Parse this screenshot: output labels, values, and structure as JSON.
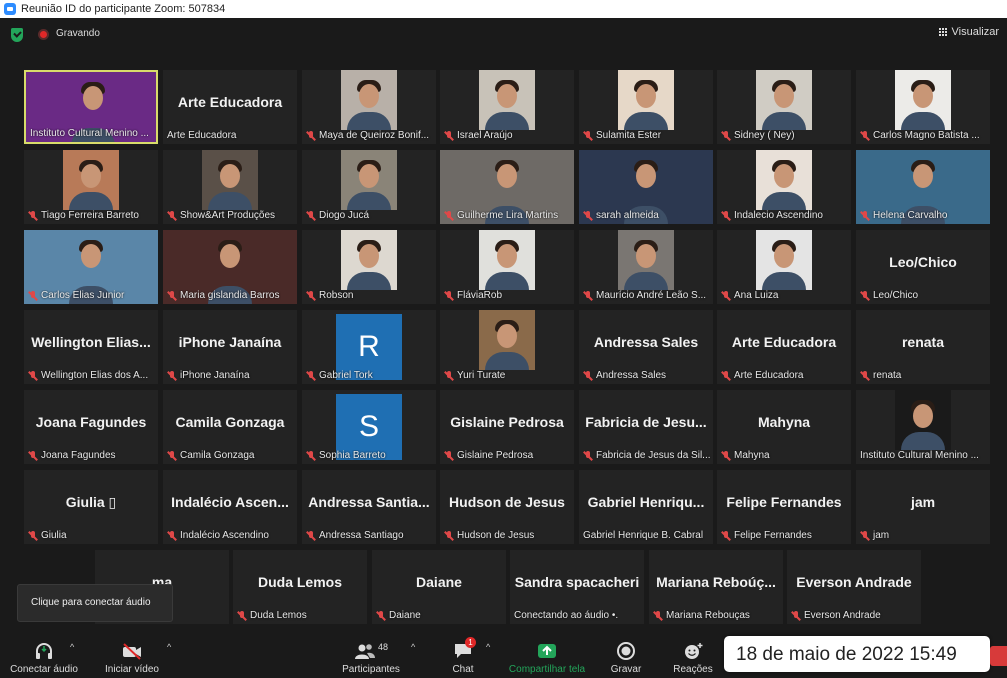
{
  "window": {
    "title": "Reunião ID do participante Zoom: 507834"
  },
  "topbar": {
    "recording_label": "Gravando",
    "view_label": "Visualizar"
  },
  "tiles": [
    {
      "label": "Instituto Cultural Menino ...",
      "big": "",
      "type": "photo-wide",
      "muted": false,
      "active": true,
      "color": "#6a2a85"
    },
    {
      "label": "Arte Educadora",
      "big": "Arte Educadora",
      "type": "name",
      "muted": false
    },
    {
      "label": "Maya de Queiroz Bonif...",
      "big": "",
      "type": "photo",
      "muted": true,
      "color": "#b8b0a8"
    },
    {
      "label": "Israel Araújo",
      "big": "",
      "type": "photo",
      "muted": true,
      "color": "#c8c2b8"
    },
    {
      "label": "Sulamita Ester",
      "big": "",
      "type": "photo",
      "muted": true,
      "color": "#e6d8c8"
    },
    {
      "label": "Sidney ( Ney)",
      "big": "",
      "type": "photo",
      "muted": true,
      "color": "#d0ccc4"
    },
    {
      "label": "Carlos Magno Batista ...",
      "big": "",
      "type": "photo",
      "muted": true,
      "color": "#ecebe8"
    },
    {
      "label": "Tiago Ferreira Barreto",
      "big": "",
      "type": "photo",
      "muted": true,
      "color": "#b87a58"
    },
    {
      "label": "Show&Art Produções",
      "big": "",
      "type": "photo",
      "muted": true,
      "color": "#5a5048"
    },
    {
      "label": "Diogo Jucá",
      "big": "",
      "type": "photo",
      "muted": true,
      "color": "#8a8478"
    },
    {
      "label": "Guilherme Lira Martins",
      "big": "",
      "type": "photo-wide",
      "muted": true,
      "color": "#6e6a66"
    },
    {
      "label": "sarah almeida",
      "big": "",
      "type": "photo-wide",
      "muted": true,
      "color": "#2c3850"
    },
    {
      "label": "Indalecio Ascendino",
      "big": "",
      "type": "photo",
      "muted": true,
      "color": "#e8e0d8"
    },
    {
      "label": "Helena Carvalho",
      "big": "",
      "type": "photo-wide",
      "muted": true,
      "color": "#3a6a8a"
    },
    {
      "label": "Carlos Elias Junior",
      "big": "",
      "type": "photo-wide",
      "muted": true,
      "color": "#5a86a8"
    },
    {
      "label": "Maria gislandia Barros",
      "big": "",
      "type": "photo-wide",
      "muted": true,
      "color": "#4a2a28"
    },
    {
      "label": "Robson",
      "big": "",
      "type": "photo",
      "muted": true,
      "color": "#ddd8d0"
    },
    {
      "label": "FláviaRob",
      "big": "",
      "type": "photo",
      "muted": true,
      "color": "#e0e0dc"
    },
    {
      "label": "Maurício André Leão S...",
      "big": "",
      "type": "photo",
      "muted": true,
      "color": "#7a7672"
    },
    {
      "label": "Ana Luiza",
      "big": "",
      "type": "photo",
      "muted": true,
      "color": "#e4e4e4"
    },
    {
      "label": "Leo/Chico",
      "big": "Leo/Chico",
      "type": "name",
      "muted": true
    },
    {
      "label": "Wellington Elias dos A...",
      "big": "Wellington Elias...",
      "type": "name",
      "muted": true
    },
    {
      "label": "iPhone Janaína",
      "big": "iPhone Janaína",
      "type": "name",
      "muted": true
    },
    {
      "label": "Gabriel Tork",
      "big": "",
      "type": "letter",
      "letter": "R",
      "muted": true
    },
    {
      "label": "Yuri Turate",
      "big": "",
      "type": "photo",
      "muted": true,
      "color": "#8a6a4a"
    },
    {
      "label": "Andressa Sales",
      "big": "Andressa Sales",
      "type": "name",
      "muted": true
    },
    {
      "label": "Arte Educadora",
      "big": "Arte Educadora",
      "type": "name",
      "muted": true
    },
    {
      "label": "renata",
      "big": "renata",
      "type": "name",
      "muted": true
    },
    {
      "label": "Joana Fagundes",
      "big": "Joana Fagundes",
      "type": "name",
      "muted": true
    },
    {
      "label": "Camila Gonzaga",
      "big": "Camila Gonzaga",
      "type": "name",
      "muted": true
    },
    {
      "label": "Sophia Barreto",
      "big": "",
      "type": "letter",
      "letter": "S",
      "muted": true
    },
    {
      "label": "Gislaine Pedrosa",
      "big": "Gislaine Pedrosa",
      "type": "name",
      "muted": true
    },
    {
      "label": "Fabricia de Jesus da Sil...",
      "big": "Fabricia de Jesu...",
      "type": "name",
      "muted": true
    },
    {
      "label": "Mahyna",
      "big": "Mahyna",
      "type": "name",
      "muted": true
    },
    {
      "label": "Instituto Cultural Menino ...",
      "big": "",
      "type": "photo",
      "muted": false,
      "color": "#1a1a1a"
    },
    {
      "label": "Giulia",
      "big": "Giulia ▯",
      "type": "name",
      "muted": true
    },
    {
      "label": "Indalécio Ascendino",
      "big": "Indalécio Ascen...",
      "type": "name",
      "muted": true
    },
    {
      "label": "Andressa Santiago",
      "big": "Andressa Santia...",
      "type": "name",
      "muted": true
    },
    {
      "label": "Hudson de Jesus",
      "big": "Hudson de Jesus",
      "type": "name",
      "muted": true
    },
    {
      "label": "Gabriel Henrique B. Cabral",
      "big": "Gabriel Henriqu...",
      "type": "name",
      "muted": false
    },
    {
      "label": "Felipe Fernandes",
      "big": "Felipe Fernandes",
      "type": "name",
      "muted": true
    },
    {
      "label": "jam",
      "big": "jam",
      "type": "name",
      "muted": true
    },
    {
      "label": "",
      "big": "ma",
      "type": "name",
      "muted": false
    },
    {
      "label": "Duda Lemos",
      "big": "Duda Lemos",
      "type": "name",
      "muted": true
    },
    {
      "label": "Daiane",
      "big": "Daiane",
      "type": "name",
      "muted": true
    },
    {
      "label": "Conectando ao áudio •.",
      "big": "Sandra spacacheri",
      "type": "name",
      "muted": false
    },
    {
      "label": "Mariana Rebouças",
      "big": "Mariana Reboúç...",
      "type": "name",
      "muted": true
    },
    {
      "label": "Everson Andrade",
      "big": "Everson Andrade",
      "type": "name",
      "muted": true
    }
  ],
  "tooltip": "Clique para conectar áudio",
  "toolbar": {
    "audio_label": "Conectar áudio",
    "video_label": "Iniciar vídeo",
    "participants_label": "Participantes",
    "participants_count": "48",
    "chat_label": "Chat",
    "chat_badge": "1",
    "share_label": "Compartilhar tela",
    "record_label": "Gravar",
    "reactions_label": "Reações",
    "share_color": "#23a55a"
  },
  "datetime": "18 de maio de 2022 15:49"
}
